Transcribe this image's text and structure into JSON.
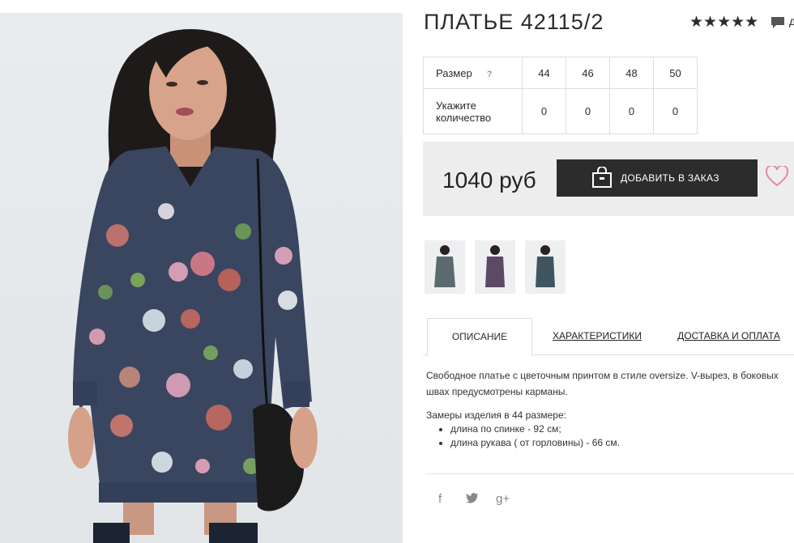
{
  "product": {
    "title": "ПЛАТЬЕ 42115/2",
    "rating_stars": "★★★★★",
    "comments_label": "д"
  },
  "sizes": {
    "size_label": "Размер",
    "help": "?",
    "quantity_label": "Укажите количество",
    "columns": [
      {
        "size": "44",
        "qty": "0"
      },
      {
        "size": "46",
        "qty": "0"
      },
      {
        "size": "48",
        "qty": "0"
      },
      {
        "size": "50",
        "qty": "0"
      }
    ]
  },
  "buy": {
    "price": "1040 руб",
    "add_button": "ДОБАВИТЬ В ЗАКАЗ"
  },
  "tabs": [
    {
      "label": "ОПИСАНИЕ"
    },
    {
      "label": "ХАРАКТЕРИСТИКИ"
    },
    {
      "label": "ДОСТАВКА И ОПЛАТА"
    }
  ],
  "description": {
    "text": "Свободное платье с цветочным принтом в стиле oversize. V-вырез, в боковых швах предусмотрены карманы.",
    "measure_title": "Замеры изделия в 44 размере:",
    "measures": [
      "длина по спинке - 92 см;",
      "длина рукава ( от горловины) - 66 см."
    ]
  },
  "social": {
    "facebook": "f",
    "twitter": "t",
    "google": "g+"
  },
  "colors": {
    "accent_dark": "#2c2c2c",
    "heart": "#e48aa3",
    "dress": "#3a4660"
  }
}
